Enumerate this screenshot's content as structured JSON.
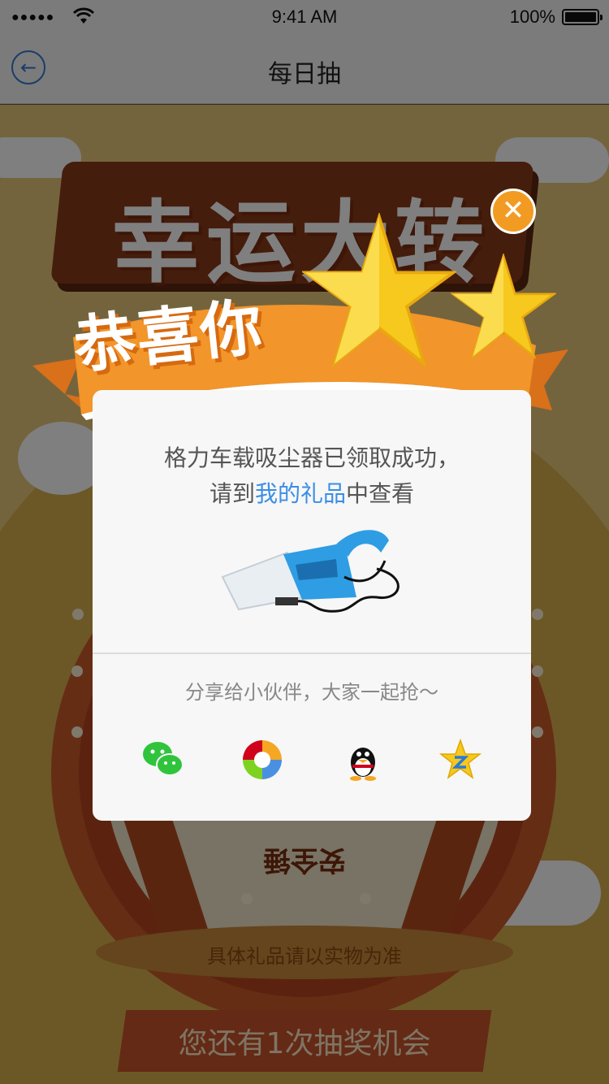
{
  "status_bar": {
    "signal": "●●●●●",
    "time": "9:41 AM",
    "battery": "100%"
  },
  "navbar": {
    "back_icon": "←",
    "title": "每日抽"
  },
  "background": {
    "banner_title": "幸运大转盘",
    "wheel_bottom_label": "安全锤",
    "base_note": "具体礼品请以实物为准",
    "chance_button": "您还有1次抽奖机会"
  },
  "modal": {
    "ribbon_title": "恭喜你",
    "close_icon": "✕",
    "message_line1": "格力车载吸尘器已领取成功，",
    "message_line2_prefix": "请到",
    "message_line2_link": "我的礼品",
    "message_line2_suffix": "中查看",
    "share_prompt": "分享给小伙伴，大家一起抢～",
    "share_icons": [
      "wechat-icon",
      "moments-icon",
      "qq-icon",
      "qzone-icon"
    ]
  },
  "colors": {
    "accent_blue": "#3a8ee6",
    "ribbon_orange": "#f2952a",
    "star_yellow": "#f7c81e",
    "wechat_green": "#2fc43c"
  }
}
